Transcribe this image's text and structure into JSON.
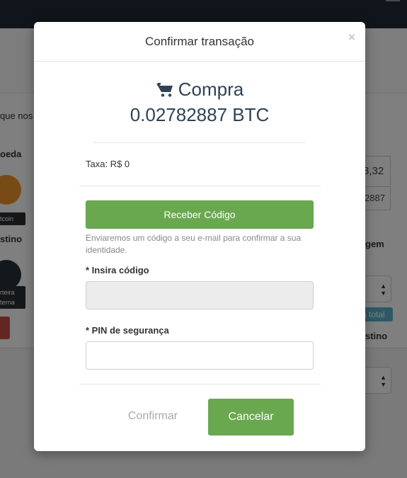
{
  "background": {
    "snippet_text": "que nos",
    "section_coin": "oeda",
    "coin_label": "tcoin",
    "section_destination": "stino",
    "wallet_label_line1": "rteira",
    "wallet_label_line2": "terna",
    "value_box_1": "3,32",
    "value_box_2": "2887",
    "right_heading": "gem",
    "badge_text": "a total",
    "right_heading_2": "stino"
  },
  "modal": {
    "title": "Confirmar transação",
    "close_label": "×",
    "summary_type": "Compra",
    "summary_amount": "0.02782887 BTC",
    "fee_text": "Taxa: R$ 0",
    "receive_code_button": "Receber Código",
    "help_text": "Enviaremos um código a seu e-mail para confirmar a sua identidade.",
    "code_label": "* Insira código",
    "code_value": "",
    "pin_label": "* PIN de segurança",
    "pin_value": "",
    "confirm_button": "Confirmar",
    "cancel_button": "Cancelar"
  },
  "icons": {
    "cart": "shopping-cart-icon",
    "close": "close-icon"
  },
  "colors": {
    "primary_green": "#6aa84f",
    "heading_navy": "#2f4356"
  }
}
